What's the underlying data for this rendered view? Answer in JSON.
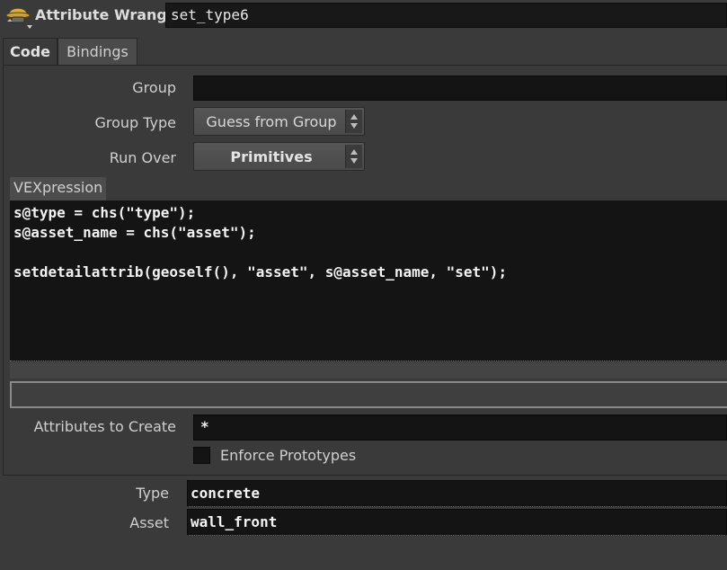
{
  "header": {
    "node_type": "Attribute Wrangle",
    "node_name": "set_type6",
    "icon": "wrangle-node-icon"
  },
  "tabs": [
    {
      "label": "Code",
      "active": true
    },
    {
      "label": "Bindings",
      "active": false
    }
  ],
  "params": {
    "group_label": "Group",
    "group_value": "",
    "group_type_label": "Group Type",
    "group_type_value": "Guess from Group",
    "run_over_label": "Run Over",
    "run_over_value": "Primitives",
    "vexpression_label": "VEXpression",
    "code_lines": [
      "s@type = chs(\"type\");",
      "s@asset_name = chs(\"asset\");",
      "",
      "setdetailattrib(geoself(), \"asset\", s@asset_name, \"set\");"
    ],
    "attributes_to_create_label": "Attributes to Create",
    "attributes_to_create_value": "*",
    "enforce_prototypes_label": "Enforce Prototypes",
    "enforce_prototypes_checked": false
  },
  "spare_params": {
    "type_label": "Type",
    "type_value": "concrete",
    "asset_label": "Asset",
    "asset_value": "wall_front"
  },
  "colors": {
    "background": "#3a3a3a",
    "field": "#141414",
    "text": "#d6d6d6"
  }
}
